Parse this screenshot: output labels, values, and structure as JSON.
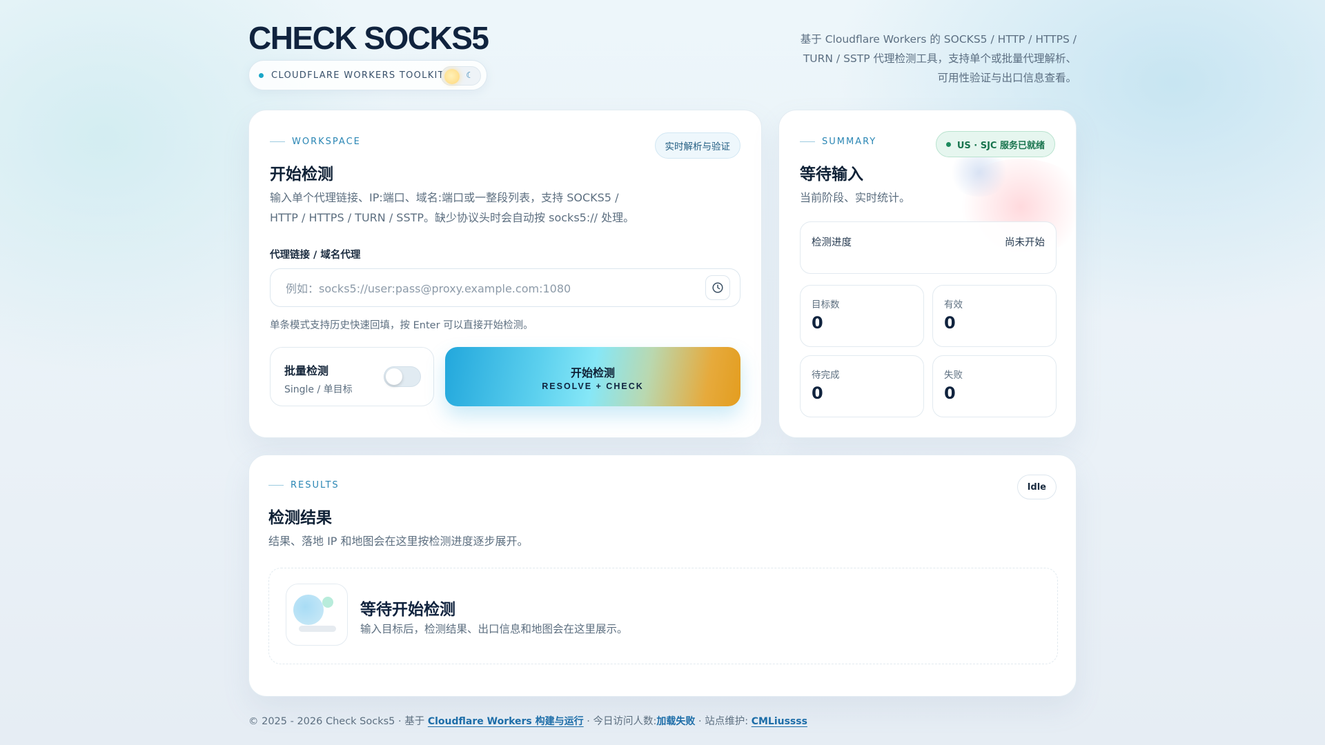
{
  "header": {
    "title": "CHECK SOCKS5",
    "toolkit_label": "CLOUDFLARE WORKERS TOOLKIT",
    "tagline_line1": "基于 Cloudflare Workers 的 SOCKS5 / HTTP / HTTPS /",
    "tagline_line2": "TURN / SSTP 代理检测工具，支持单个或批量代理解析、",
    "tagline_line3": "可用性验证与出口信息查看。",
    "theme_icons": [
      "sun-icon",
      "moon-icon"
    ]
  },
  "workspace": {
    "section_label": "WORKSPACE",
    "badge": "实时解析与验证",
    "title": "开始检测",
    "desc_line1": "输入单个代理链接、IP:端口、域名:端口或一整段列表，支持 SOCKS5 /",
    "desc_line2": "HTTP / HTTPS / TURN / SSTP。缺少协议头时会自动按 socks5:// 处理。",
    "field_label": "代理链接 / 域名代理",
    "input_value": "",
    "input_placeholder": "例如：socks5://user:pass@proxy.example.com:1080",
    "hint": "单条模式支持历史快速回填，按 Enter 可以直接开始检测。",
    "batch_title": "批量检测",
    "batch_sub": "Single / 单目标",
    "batch_enabled": false,
    "start_label": "开始检测",
    "start_sub": "RESOLVE + CHECK"
  },
  "summary": {
    "section_label": "SUMMARY",
    "status_badge": "US · SJC 服务已就绪",
    "title": "等待输入",
    "desc": "当前阶段、实时统计。",
    "progress_label": "检测进度",
    "progress_status": "尚未开始",
    "stats": [
      {
        "label": "目标数",
        "value": "0"
      },
      {
        "label": "有效",
        "value": "0"
      },
      {
        "label": "待完成",
        "value": "0"
      },
      {
        "label": "失败",
        "value": "0"
      }
    ]
  },
  "results": {
    "section_label": "RESULTS",
    "status": "Idle",
    "title": "检测结果",
    "desc": "结果、落地 IP 和地图会在这里按检测进度逐步展开。",
    "empty_title": "等待开始检测",
    "empty_desc": "输入目标后，检测结果、出口信息和地图会在这里展示。"
  },
  "footer": {
    "prefix": "© 2025 - 2026 Check Socks5 · 基于 ",
    "link_platform": "Cloudflare Workers 构建与运行",
    "visitors_label": " · 今日访问人数:",
    "visitors_value": "加载失败",
    "maintainer_label": " · 站点维护: ",
    "maintainer": "CMLiussss"
  },
  "colors": {
    "accent": "#2a86b4",
    "title": "#10233e",
    "ready_green": "#19744e",
    "button_start": "#22a7dc",
    "button_end": "#e39d1f"
  }
}
